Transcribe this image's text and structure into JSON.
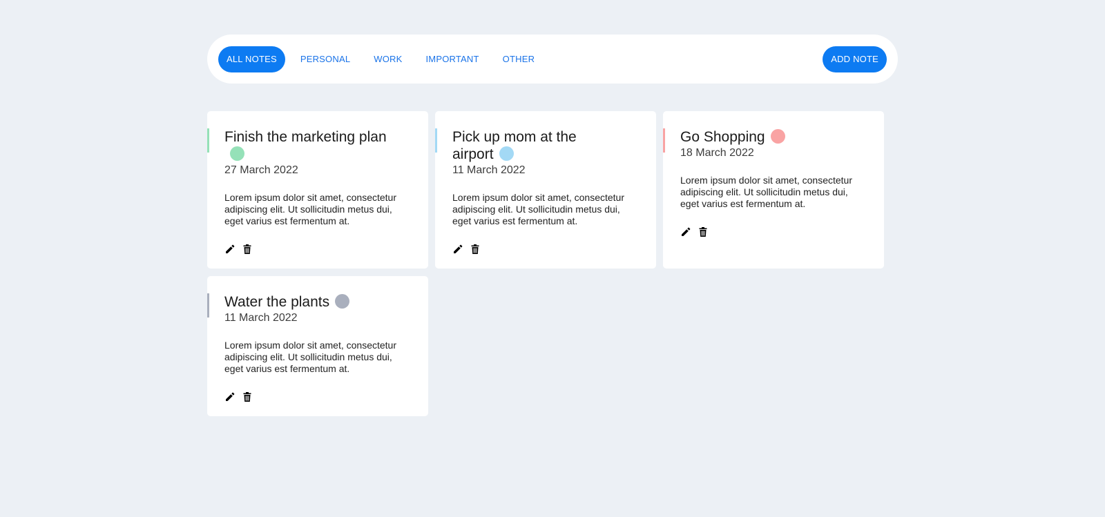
{
  "nav": {
    "tabs": [
      {
        "label": "ALL NOTES",
        "active": true
      },
      {
        "label": "PERSONAL",
        "active": false
      },
      {
        "label": "WORK",
        "active": false
      },
      {
        "label": "IMPORTANT",
        "active": false
      },
      {
        "label": "OTHER",
        "active": false
      }
    ],
    "add_label": "ADD NOTE"
  },
  "colors": {
    "background": "#ecf0f5",
    "primary": "#0d7bf2",
    "personal": "#95e1b8",
    "work": "#a3d9f5",
    "important": "#f9a3a3",
    "other": "#a9afbd"
  },
  "notes": [
    {
      "title": "Finish the marketing plan",
      "date": "27 March 2022",
      "category_color": "#95e1b8",
      "body": "Lorem ipsum dolor sit amet, consectetur adipiscing elit. Ut sollicitudin metus dui, eget varius est fermentum at.",
      "icons": [
        "pencil-icon",
        "trash-icon"
      ]
    },
    {
      "title": "Pick up mom at the airport",
      "date": "11 March 2022",
      "category_color": "#a3d9f5",
      "body": "Lorem ipsum dolor sit amet, consectetur adipiscing elit. Ut sollicitudin metus dui, eget varius est fermentum at.",
      "icons": [
        "pencil-icon",
        "trash-icon"
      ]
    },
    {
      "title": "Go Shopping",
      "date": "18 March 2022",
      "category_color": "#f9a3a3",
      "body": "Lorem ipsum dolor sit amet, consectetur adipiscing elit. Ut sollicitudin metus dui, eget varius est fermentum at.",
      "icons": [
        "pencil-icon",
        "trash-icon"
      ]
    },
    {
      "title": "Water the plants",
      "date": "11 March 2022",
      "category_color": "#a9afbd",
      "body": "Lorem ipsum dolor sit amet, consectetur adipiscing elit. Ut sollicitudin metus dui, eget varius est fermentum at.",
      "icons": [
        "pencil-icon",
        "trash-icon"
      ]
    }
  ]
}
